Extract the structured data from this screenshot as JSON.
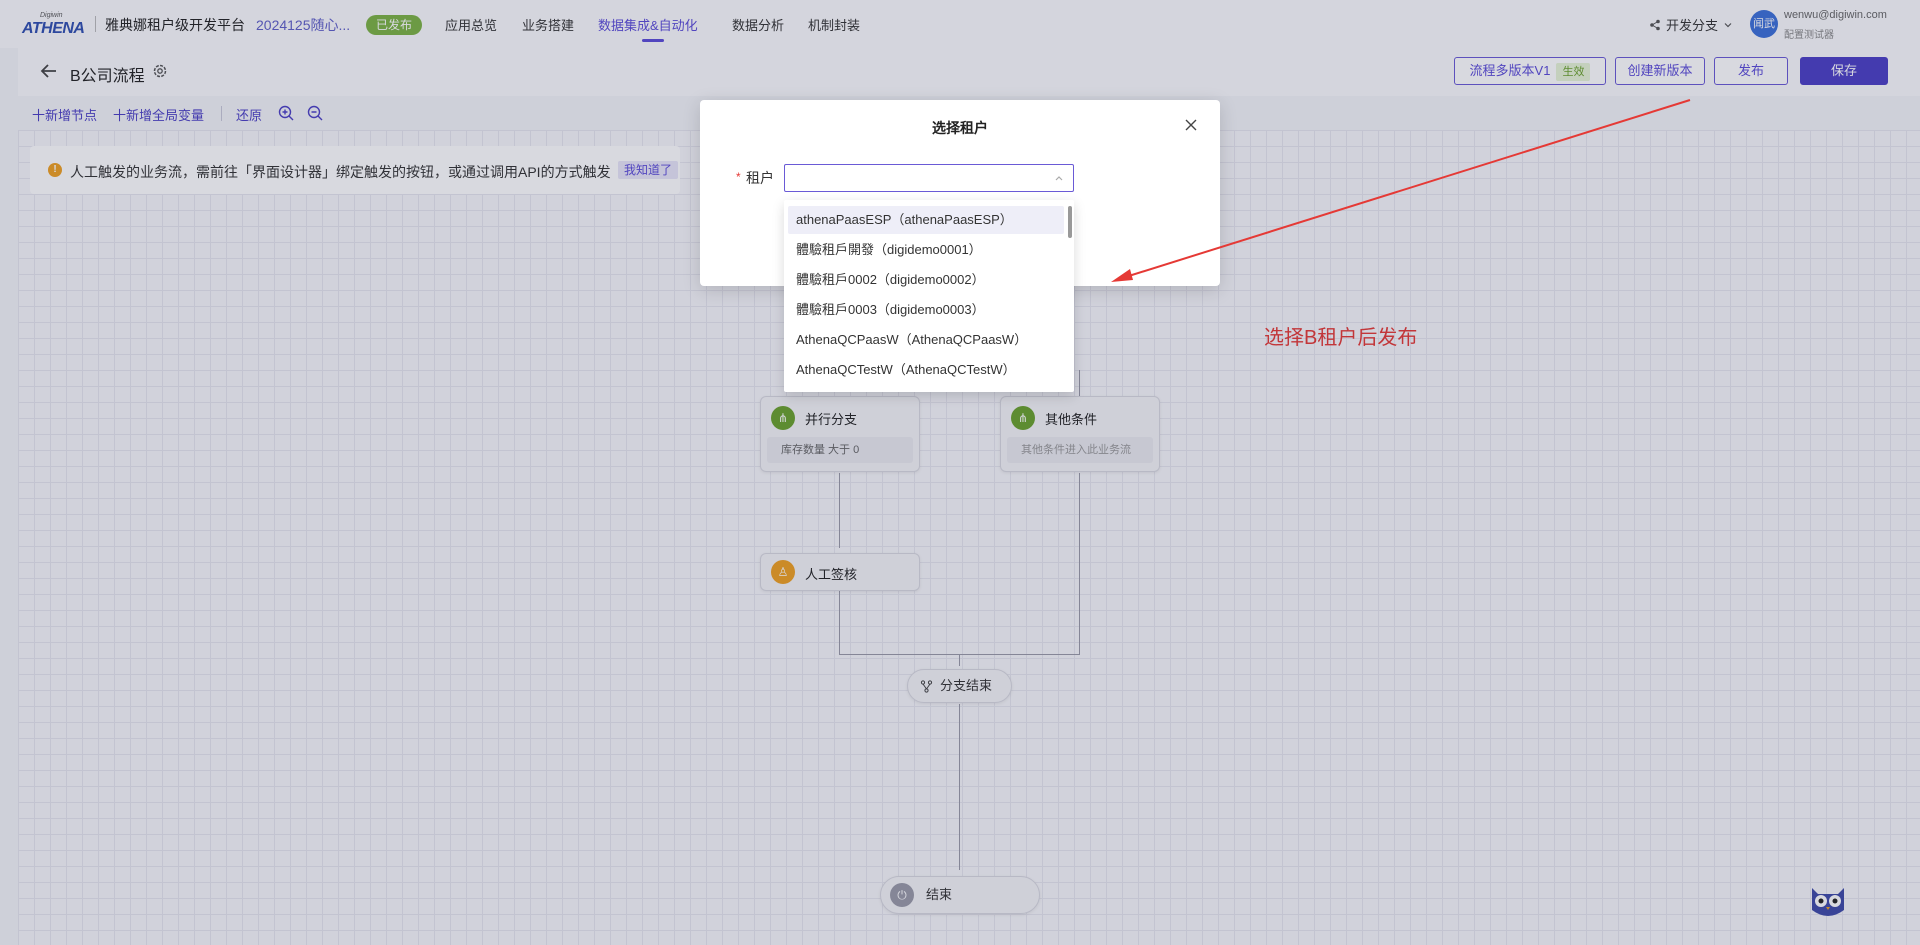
{
  "topnav": {
    "logo_small": "Digiwin",
    "logo_text": "ATHENA",
    "platform_title": "雅典娜租户级开发平台",
    "app_name": "2024125随心...",
    "status": "已发布",
    "tabs": [
      "应用总览",
      "业务搭建",
      "数据集成&自动化",
      "数据分析",
      "机制封装"
    ],
    "branch": "开发分支",
    "avatar": "闻武",
    "user_email": "wenwu@digiwin.com",
    "user_role": "配置测试器"
  },
  "subheader": {
    "title": "B公司流程",
    "version_label": "流程多版本V1",
    "version_badge": "生效",
    "create_version": "创建新版本",
    "publish": "发布",
    "save": "保存"
  },
  "toolbar": {
    "add_node": "十新增节点",
    "add_global_var": "十新增全局变量",
    "restore": "还原"
  },
  "notice": {
    "text": "人工触发的业务流，需前往「界面设计器」绑定触发的按钮，或通过调用API的方式触发",
    "ack": "我知道了"
  },
  "flow": {
    "parallel_title": "并行分支",
    "parallel_cond": "库存数量 大于 0",
    "other_title": "其他条件",
    "other_cond": "其他条件进入此业务流",
    "manual_sign": "人工签核",
    "branch_end": "分支结束",
    "end": "结束"
  },
  "annotation": "选择B租户后发布",
  "modal": {
    "title": "选择租户",
    "required_mark": "*",
    "field_label": "租户",
    "options": [
      "athenaPaasESP（athenaPaasESP）",
      "體驗租戶開發（digidemo0001）",
      "體驗租戶0002（digidemo0002）",
      "體驗租戶0003（digidemo0003）",
      "AthenaQCPaasW（AthenaQCPaasW）",
      "AthenaQCTestW（AthenaQCTestW）"
    ]
  },
  "icons": {
    "back": "arrow-left-icon",
    "settings": "gear-icon",
    "zoom_in": "zoom-in-icon",
    "zoom_out": "zoom-out-icon",
    "close": "close-icon",
    "branch": "share-icon",
    "assistant": "owl-assistant-icon"
  },
  "colors": {
    "accent": "#5b4bd8",
    "primary_button": "#4b3fc5",
    "published": "#7cb342",
    "annotation": "#e53935",
    "warning": "#f0a020"
  }
}
